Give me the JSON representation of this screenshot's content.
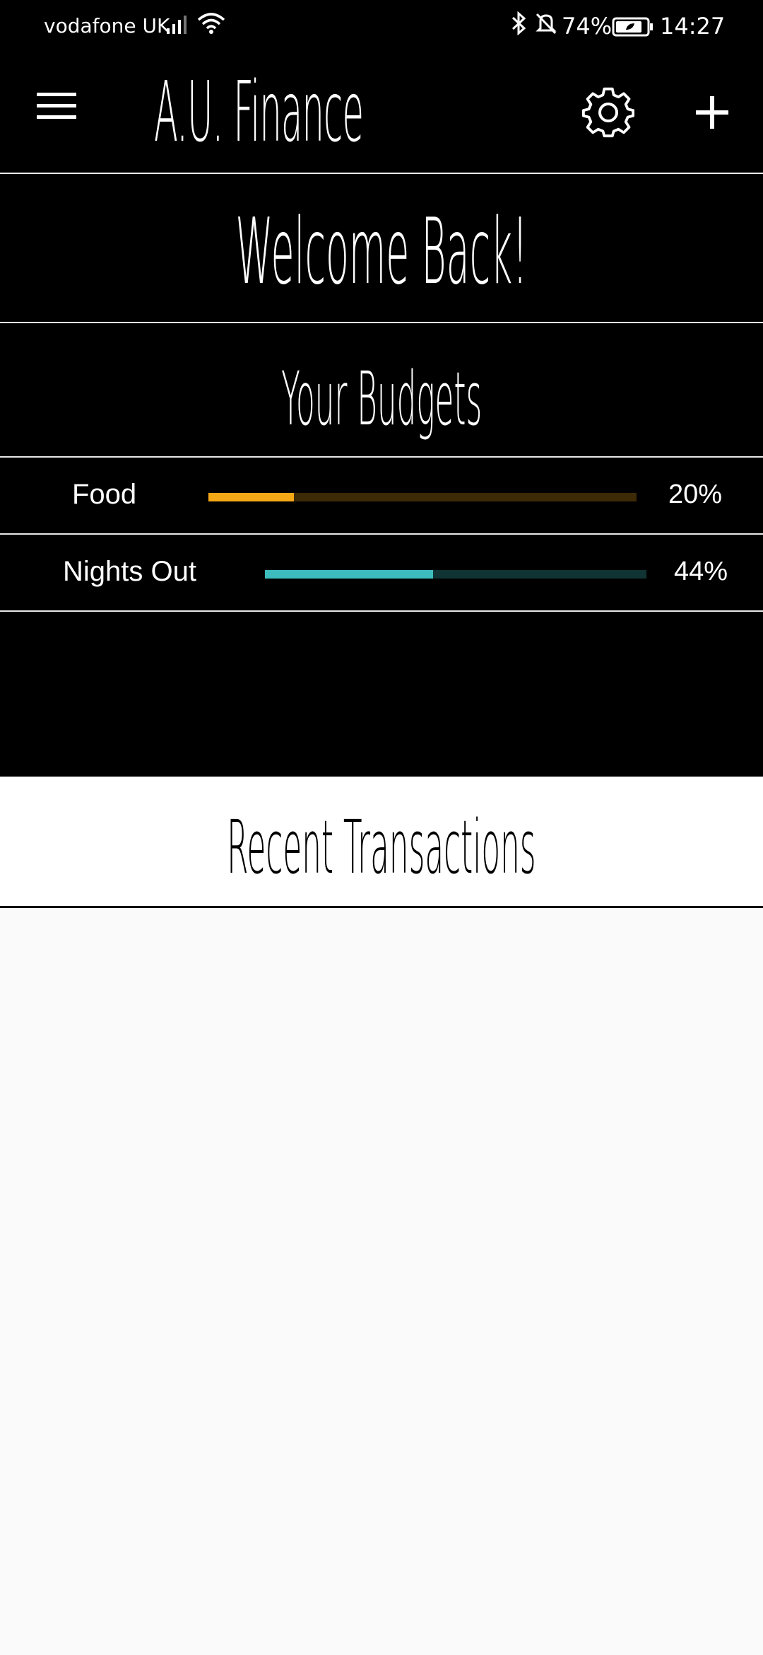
{
  "status_bar": {
    "carrier": "vodafone UK",
    "battery": "74%",
    "time": "14:27",
    "icons": [
      "signal-icon",
      "wifi-icon",
      "bluetooth-icon",
      "notifications-off-icon",
      "battery-icon"
    ]
  },
  "app_bar": {
    "title": "A.U. Finance",
    "icons": [
      "menu-icon",
      "gear-icon",
      "plus-icon"
    ]
  },
  "welcome": "Welcome Back!",
  "budgets_heading": "Your Budgets",
  "budgets": [
    {
      "name": "Food",
      "percent_label": "20%",
      "progress": 0.2,
      "color": "#f5a816",
      "track_color": "#3d2a06"
    },
    {
      "name": "Nights Out",
      "percent_label": "44%",
      "progress": 0.44,
      "color": "#3cbcbc",
      "track_color": "#103333"
    }
  ],
  "recent_transactions_heading": "Recent Transactions",
  "colors": {
    "background_dark": "#000000",
    "panel_light": "#ffffff",
    "list_background": "#fafafa"
  }
}
